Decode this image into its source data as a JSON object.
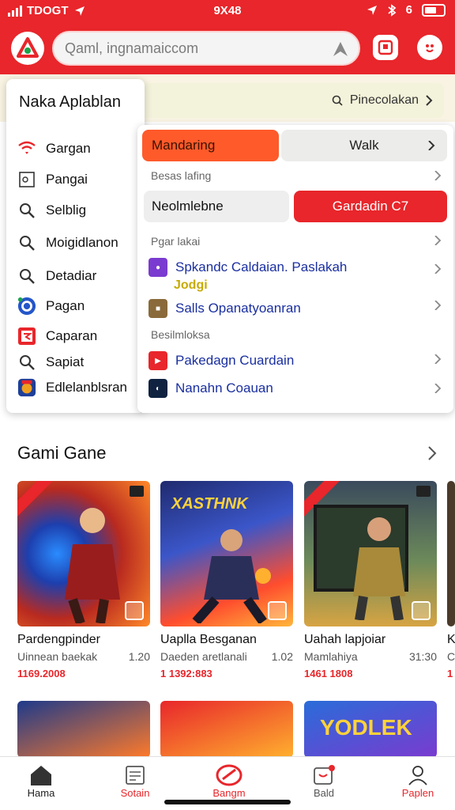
{
  "status": {
    "carrier": "TDOGT",
    "time": "9X48",
    "net": "6"
  },
  "search": {
    "placeholder": "Qaml, ingnamaiccom"
  },
  "promo": {
    "label": "Pinecolakan"
  },
  "menu": {
    "title": "Naka Aplablan",
    "items": [
      {
        "label": "Gargan",
        "icon": "wifi-icon"
      },
      {
        "label": "Pangai",
        "icon": "frame-icon"
      },
      {
        "label": "Selblig",
        "icon": "search-icon"
      },
      {
        "label": "Moigidlanon",
        "icon": "search-icon"
      },
      {
        "label": "Detadiar",
        "icon": "search-icon"
      },
      {
        "label": "Pagan",
        "icon": "app-blue-icon"
      },
      {
        "label": "Caparan",
        "icon": "app-red-icon"
      },
      {
        "label": "Sapiat",
        "icon": "search-icon"
      },
      {
        "label": "Edlelanblsran",
        "icon": "app-game-icon"
      }
    ]
  },
  "dropdown": {
    "seg_active": "Mandaring",
    "seg_other": "Walk",
    "subhead1": "Besas lafing",
    "seg_left": "Neolmlebne",
    "seg_red": "Gardadin C7",
    "subhead2": "Pgar lakai",
    "rows1": [
      {
        "label": "Spkandc Caldaian. Paslakah",
        "sub": "Jodgi",
        "icon": "app-purple-icon"
      },
      {
        "label": "Salls Opanatyoanran",
        "icon": "app-brown-icon"
      }
    ],
    "subhead3": "Besilmloksa",
    "rows2": [
      {
        "label": "Pakedagn Cuardain",
        "icon": "app-red-icon"
      },
      {
        "label": "Nanahn Coauan",
        "icon": "app-dark-icon"
      }
    ]
  },
  "section": {
    "title": "Gami Gane"
  },
  "cards": [
    {
      "title": "Pardengpinder",
      "subtitle": "Uinnean baekak",
      "rating": "1.20",
      "price": "1169.2008",
      "icon": "game-art-1"
    },
    {
      "title": "Uaplla Besganan",
      "subtitle": "Daeden aretlanali",
      "rating": "1.02",
      "price": "1 1392:883",
      "art_text": "XASTHNK",
      "icon": "game-art-2"
    },
    {
      "title": "Uahah lapjoiar",
      "subtitle": "Mamlahiya",
      "rating": "31:30",
      "price": "1461 1808",
      "icon": "game-art-3"
    },
    {
      "title": "K",
      "subtitle": "C",
      "price": "1",
      "icon": "game-art-4"
    }
  ],
  "cards_row2": [
    {
      "icon": "game-art-5"
    },
    {
      "icon": "game-art-6"
    },
    {
      "art_text": "YODLEK",
      "icon": "game-art-7"
    }
  ],
  "nav": [
    {
      "label": "Hama",
      "icon": "home-icon",
      "color": "#222222"
    },
    {
      "label": "Sotain",
      "icon": "document-icon",
      "color": "#e8262b"
    },
    {
      "label": "Bangm",
      "icon": "controller-icon",
      "color": "#e8262b"
    },
    {
      "label": "Bald",
      "icon": "notification-icon",
      "color": "#555555"
    },
    {
      "label": "Paplen",
      "icon": "profile-icon",
      "color": "#e8262b"
    }
  ],
  "colors": {
    "brand": "#e8262b",
    "accent_orange": "#ff5a2a",
    "link_blue": "#1a2fa0"
  }
}
